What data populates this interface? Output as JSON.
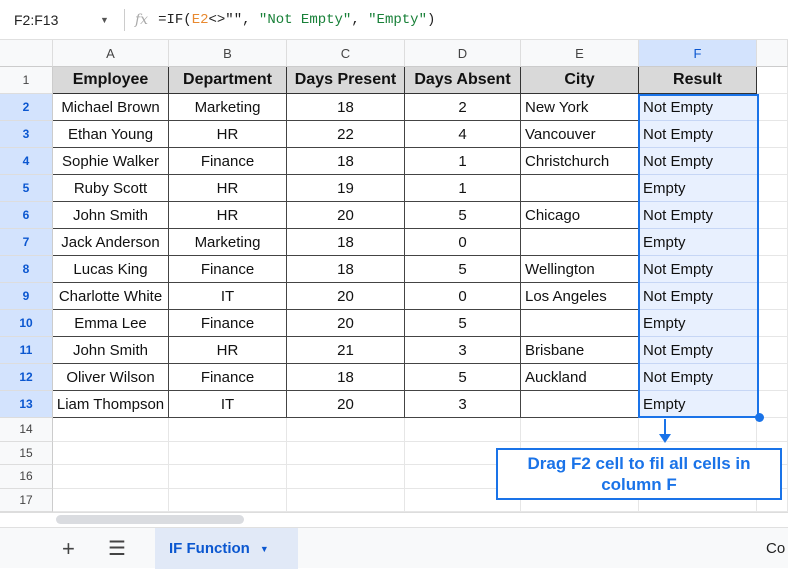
{
  "formula_bar": {
    "name_box": "F2:F13",
    "fx": "fx",
    "formula_parts": [
      "=IF(",
      "E2",
      "<>\"\", ",
      "\"Not Empty\"",
      ", ",
      "\"Empty\"",
      ")"
    ]
  },
  "columns": [
    "A",
    "B",
    "C",
    "D",
    "E",
    "F"
  ],
  "headers": [
    "Employee",
    "Department",
    "Days Present",
    "Days Absent",
    "City",
    "Result"
  ],
  "rows": [
    [
      "Michael Brown",
      "Marketing",
      "18",
      "2",
      "New York",
      "Not Empty"
    ],
    [
      "Ethan Young",
      "HR",
      "22",
      "4",
      "Vancouver",
      "Not Empty"
    ],
    [
      "Sophie Walker",
      "Finance",
      "18",
      "1",
      "Christchurch",
      "Not Empty"
    ],
    [
      "Ruby Scott",
      "HR",
      "19",
      "1",
      "",
      "Empty"
    ],
    [
      "John Smith",
      "HR",
      "20",
      "5",
      "Chicago",
      "Not Empty"
    ],
    [
      "Jack Anderson",
      "Marketing",
      "18",
      "0",
      "",
      "Empty"
    ],
    [
      "Lucas King",
      "Finance",
      "18",
      "5",
      "Wellington",
      "Not Empty"
    ],
    [
      "Charlotte White",
      "IT",
      "20",
      "0",
      "Los Angeles",
      "Not Empty"
    ],
    [
      "Emma Lee",
      "Finance",
      "20",
      "5",
      "",
      "Empty"
    ],
    [
      "John Smith",
      "HR",
      "21",
      "3",
      "Brisbane",
      "Not Empty"
    ],
    [
      "Oliver Wilson",
      "Finance",
      "18",
      "5",
      "Auckland",
      "Not Empty"
    ],
    [
      "Liam Thompson",
      "IT",
      "20",
      "3",
      "",
      "Empty"
    ]
  ],
  "row_numbers": [
    "1",
    "2",
    "3",
    "4",
    "5",
    "6",
    "7",
    "8",
    "9",
    "10",
    "11",
    "12",
    "13",
    "14",
    "15",
    "16",
    "17"
  ],
  "annotation": "Drag F2 cell to fil all cells in column F",
  "sheet_tab": "IF Function",
  "bottom_right": "Co",
  "accent": "#1a73e8"
}
